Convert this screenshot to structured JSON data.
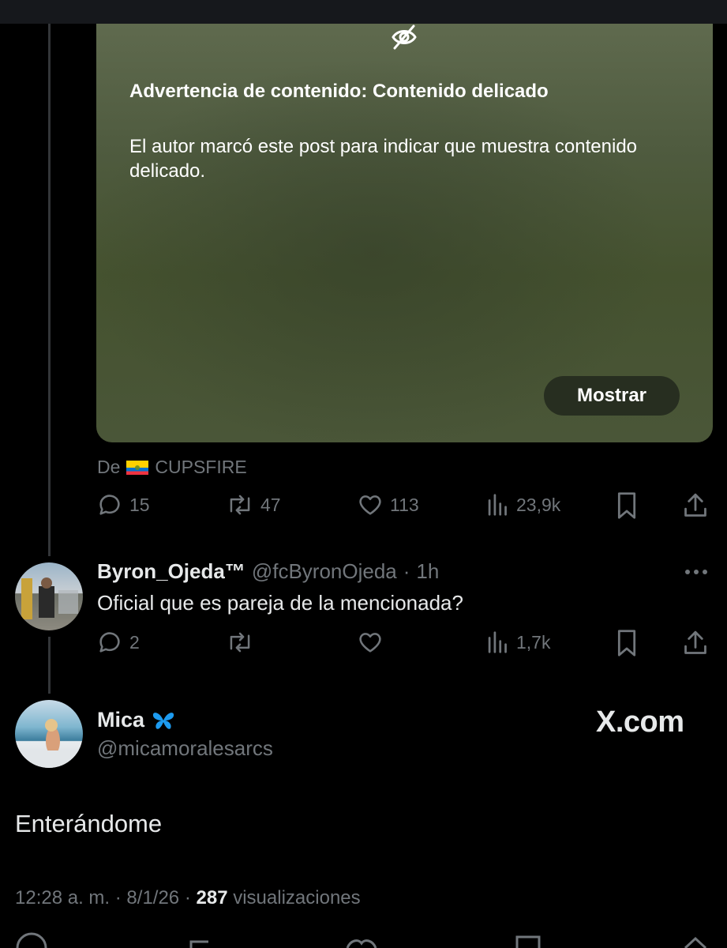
{
  "media": {
    "warning_title": "Advertencia de contenido: Contenido delicado",
    "warning_body": "El autor marcó este post para indicar que muestra contenido delicado.",
    "show_label": "Mostrar"
  },
  "source": {
    "prefix": "De",
    "account": "CUPSFIRE"
  },
  "main_post_actions": {
    "replies": "15",
    "reposts": "47",
    "likes": "113",
    "views": "23,9k"
  },
  "reply": {
    "name": "Byron_Ojeda™",
    "handle": "@fcByronOjeda",
    "separator": "·",
    "time": "1h",
    "text": "Oficial que es pareja de la mencionada?",
    "replies": "2",
    "views": "1,7k"
  },
  "quoted_author": {
    "name": "Mica",
    "handle": "@micamoralesarcs",
    "badge_icon": "butterfly-icon"
  },
  "watermark": "X.com",
  "post": {
    "text": "Enterándome",
    "time": "12:28 a. m.",
    "date": "8/1/26",
    "views_count": "287",
    "views_label": "visualizaciones",
    "sep": "·"
  },
  "colors": {
    "background": "#000000",
    "muted": "#71767b",
    "text": "#e7e9ea",
    "badge": "#1d9bf0"
  }
}
